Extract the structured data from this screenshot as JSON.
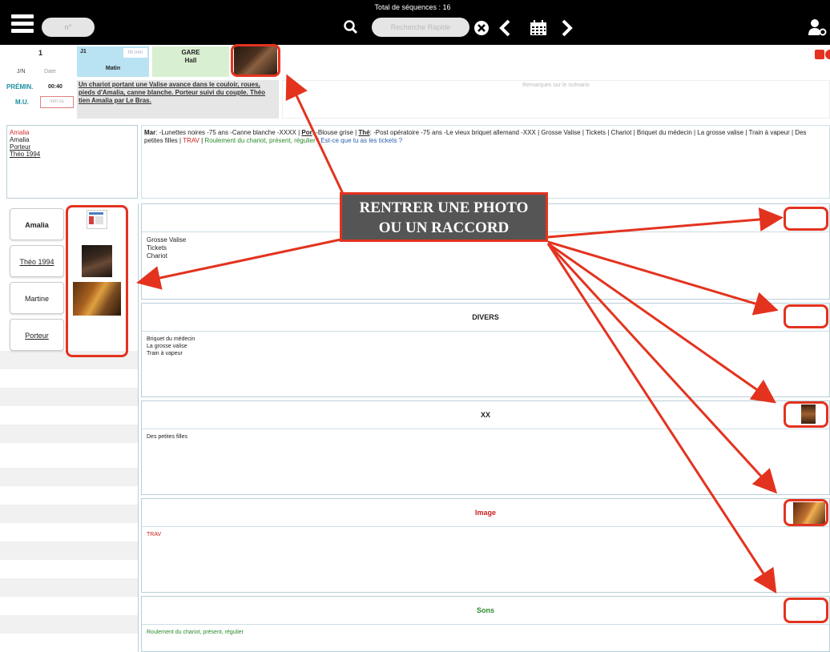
{
  "topbar": {
    "sequence_count": "Total de séquences : 16",
    "seq_pill": "n°",
    "search_placeholder": "Recherche Rapide"
  },
  "header": {
    "scene_number": "1",
    "jn_label": "J/N",
    "date_label": "Date",
    "day": "J1",
    "time_placeholder": "hh:mm",
    "moment": "Matin",
    "location": "GARE",
    "sublocation": "Hall",
    "premin_label": "PRÉMIN.",
    "premin_value": "00:40",
    "mu_label": "M.U.",
    "mu_placeholder": "mm:ss",
    "description": "Un chariot portant une Valise avance dans le couloir, roues, pieds d'Amalia, canne blanche. Porteur suivi du couple. Théo tien Amalia par Le Bras.",
    "remarks_placeholder": "Remarques sur le scénario"
  },
  "characters_list": [
    "Amalia",
    "Amalia",
    "Porteur",
    "Théo 1994"
  ],
  "summary": {
    "mar_label": "Mar",
    "mar_text": ": -Lunettes noires -75 ans -Canne blanche -XXXX | ",
    "por_label": "Por",
    "por_text": ": -Blouse grise | ",
    "the_label": "Thé",
    "the_text": ": -Post opératoire -75 ans -Le vieux briquet allemand -XXX | Grosse Valise | Tickets | Chariot | Briquet du médecin | La grosse valise | Train à vapeur | Des petites filles | ",
    "trav": "TRAV",
    "sep": " | ",
    "sound": "Roulement du chariot, présent, régulier",
    "question": " | Est-ce que tu as les tickets ?"
  },
  "character_tabs": [
    "Amalia",
    "Théo 1994",
    "Martine",
    "Porteur"
  ],
  "sections": [
    {
      "title": "",
      "body": "Grosse Valise\nTickets\nChariot"
    },
    {
      "title": "DIVERS",
      "body": "Briquet du médecin\nLa grosse valise\nTrain à vapeur"
    },
    {
      "title": "XX",
      "body": "Des petites filles"
    },
    {
      "title": "Image",
      "body": "TRAV"
    },
    {
      "title": "Sons",
      "body": "Roulement du chariot, présent, régulier"
    }
  ],
  "callout": {
    "line1": "RENTRER UNE PHOTO",
    "line2": "OU UN RACCORD"
  },
  "colors": {
    "annotation_red": "#e3331f",
    "teal": "#1a8fa0",
    "image_red": "#cc2020",
    "sound_green": "#2a8a2a",
    "question_blue": "#2a5fb0"
  }
}
